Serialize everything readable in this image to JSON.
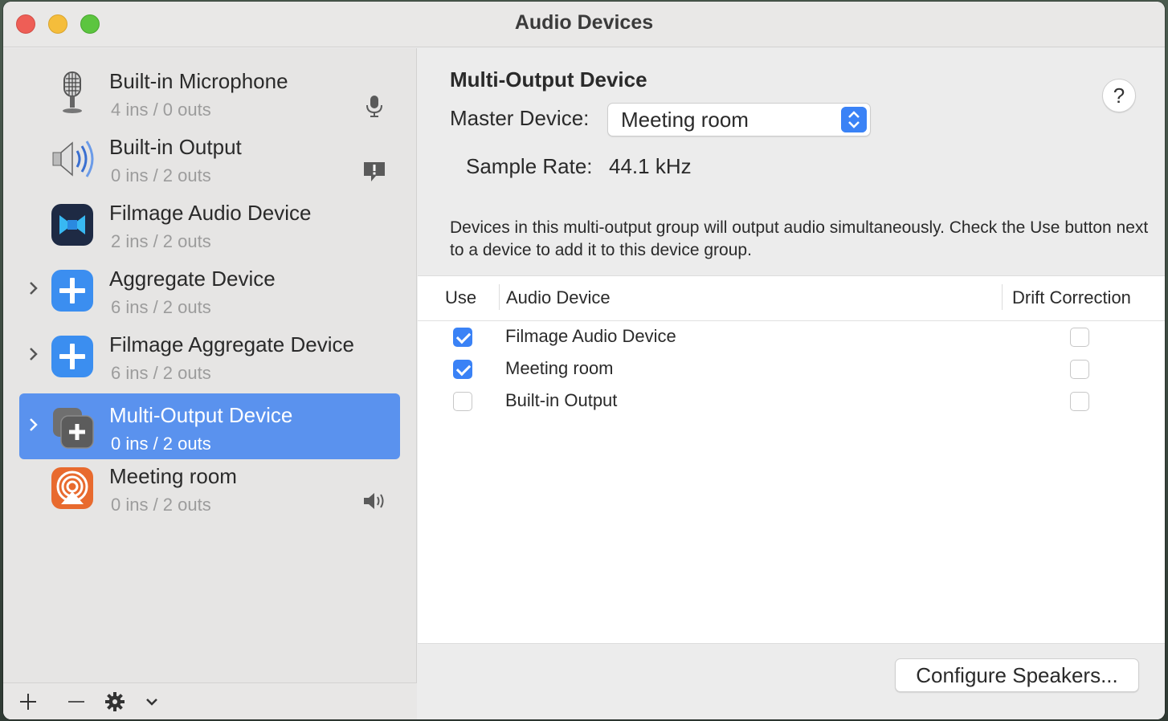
{
  "window": {
    "title": "Audio Devices"
  },
  "sidebar": {
    "devices": [
      {
        "name": "Built-in Microphone",
        "io": "4 ins / 0 outs",
        "icon": "microphone-icon",
        "status_icon": "mic-input-icon",
        "selected": false,
        "expandable": false
      },
      {
        "name": "Built-in Output",
        "io": "0 ins / 2 outs",
        "icon": "speaker-icon",
        "status_icon": "alert-bubble-icon",
        "selected": false,
        "expandable": false
      },
      {
        "name": "Filmage Audio Device",
        "io": "2 ins / 2 outs",
        "icon": "filmage-icon",
        "status_icon": "",
        "selected": false,
        "expandable": false
      },
      {
        "name": "Aggregate Device",
        "io": "6 ins / 2 outs",
        "icon": "aggregate-icon",
        "status_icon": "",
        "selected": false,
        "expandable": true
      },
      {
        "name": "Filmage Aggregate Device",
        "io": "6 ins / 2 outs",
        "icon": "aggregate-icon",
        "status_icon": "",
        "selected": false,
        "expandable": true
      },
      {
        "name": "Multi-Output Device",
        "io": "0 ins / 2 outs",
        "icon": "multi-output-icon",
        "status_icon": "",
        "selected": true,
        "expandable": true
      },
      {
        "name": "Meeting room",
        "io": "0 ins / 2 outs",
        "icon": "airplay-icon",
        "status_icon": "volume-icon",
        "selected": false,
        "expandable": false
      }
    ],
    "toolbar": {
      "add": "+",
      "remove": "—"
    }
  },
  "main": {
    "title": "Multi-Output Device",
    "help": "?",
    "master_label": "Master Device:",
    "master_value": "Meeting room",
    "sample_rate_label": "Sample Rate:",
    "sample_rate_value": "44.1 kHz",
    "description": "Devices in this multi-output group will output audio simultaneously. Check the Use button next to a device to add it to this device group.",
    "table": {
      "headers": {
        "use": "Use",
        "device": "Audio Device",
        "drift": "Drift Correction"
      },
      "rows": [
        {
          "name": "Filmage Audio Device",
          "use": true,
          "drift": false
        },
        {
          "name": "Meeting room",
          "use": true,
          "drift": false
        },
        {
          "name": "Built-in Output",
          "use": false,
          "drift": false
        }
      ]
    },
    "configure_button": "Configure Speakers..."
  },
  "colors": {
    "accent": "#3a82f6",
    "selection": "#5a92ee"
  }
}
